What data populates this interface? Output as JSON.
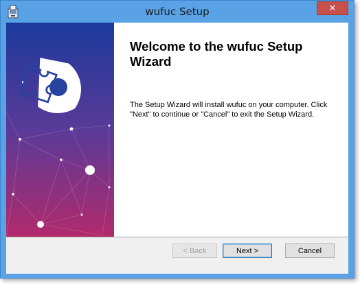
{
  "window": {
    "title": "wufuc Setup",
    "close_glyph": "✕",
    "app_icon": "installer-icon"
  },
  "content": {
    "heading": "Welcome to the wufuc Setup Wizard",
    "description": "The Setup Wizard will install wufuc on your computer.  Click \"Next\" to continue or \"Cancel\" to exit the Setup Wizard."
  },
  "buttons": {
    "back": "< Back",
    "next": "Next >",
    "cancel": "Cancel"
  },
  "banner": {
    "logo": "puzzle-logo",
    "gradient_top": "#1b3a9c",
    "gradient_bottom": "#b12a6c"
  }
}
